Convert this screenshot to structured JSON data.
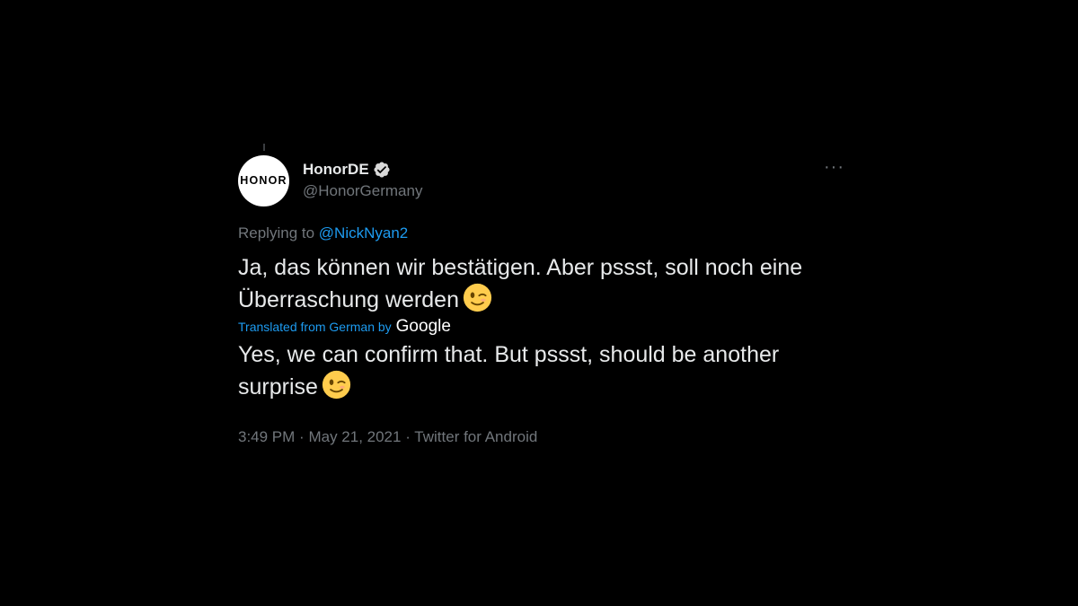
{
  "tweet": {
    "author": {
      "avatar_text": "HONOR",
      "display_name": "HonorDE",
      "handle": "@HonorGermany",
      "verified": true
    },
    "more_label": "···",
    "replying_prefix": "Replying to",
    "replying_to": "@NickNyan2",
    "text_original": "Ja, das können wir bestätigen. Aber pssst, soll noch eine Überraschung werden",
    "translated_label": "Translated from German by",
    "translator_logo": "Google",
    "text_translated": "Yes, we can confirm that. But pssst, should be another surprise",
    "time": "3:49 PM",
    "separator": "·",
    "date": "May 21, 2021",
    "source": "Twitter for Android",
    "emoji_icon": "winking-face-emoji"
  },
  "colors": {
    "background": "#000000",
    "text": "#e7e9ea",
    "muted": "#71767b",
    "link": "#1d9bf0",
    "verified_badge": "#d9d9d9"
  }
}
